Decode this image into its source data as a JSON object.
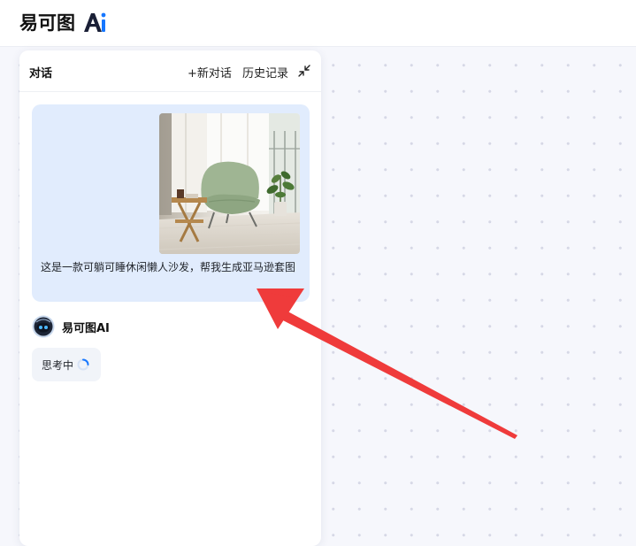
{
  "app": {
    "logo_text": "易可图",
    "brand_color": "#1677ff"
  },
  "panel": {
    "title": "对话",
    "new_chat": "+新对话",
    "history": "历史记录",
    "collapse_icon": "collapse-icon"
  },
  "user_message": {
    "text": "这是一款可躺可睡休闲懒人沙发，帮我生成亚马逊套图",
    "image_icon": "product-photo-armchair"
  },
  "assistant": {
    "name": "易可图AI",
    "status": "思考中",
    "status_icon": "loading-spinner-icon"
  },
  "annotation": {
    "color": "#ef3b3b"
  }
}
